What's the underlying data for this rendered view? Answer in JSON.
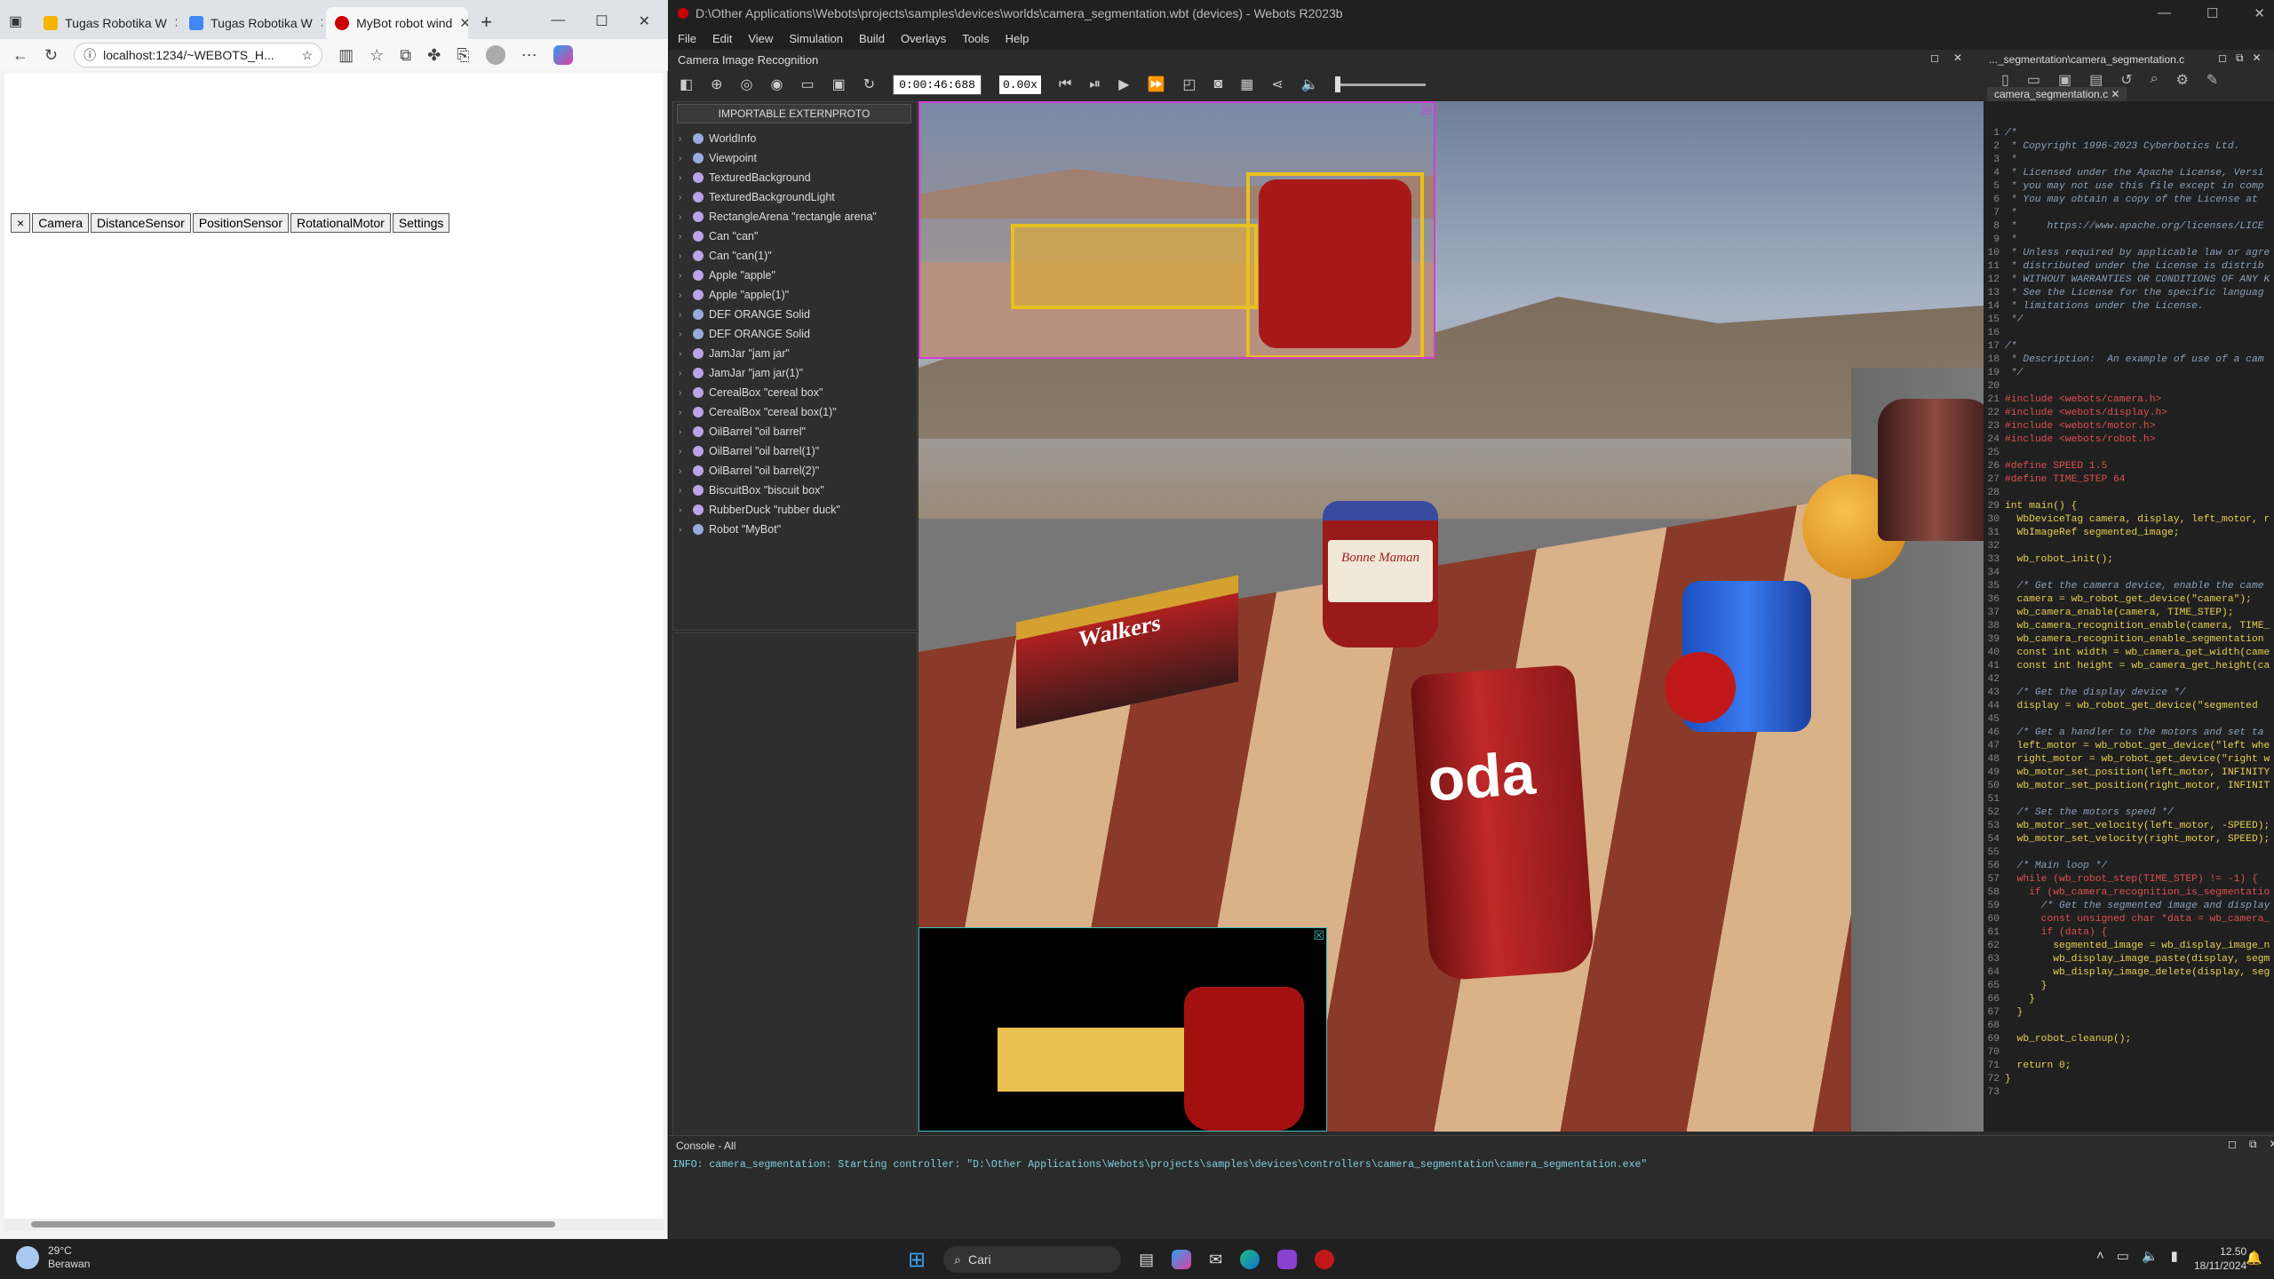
{
  "browser": {
    "tabs": [
      {
        "label": "Tugas Robotika W",
        "color": "#f4b400"
      },
      {
        "label": "Tugas Robotika W",
        "color": "#4285f4"
      },
      {
        "label": "MyBot robot wind",
        "color": "#c00"
      }
    ],
    "address": "localhost:1234/~WEBOTS_H...",
    "device_tabs": [
      "×",
      "Camera",
      "DistanceSensor",
      "PositionSensor",
      "RotationalMotor",
      "Settings"
    ]
  },
  "webots": {
    "title": "D:\\Other Applications\\Webots\\projects\\samples\\devices\\worlds\\camera_segmentation.wbt (devices) - Webots R2023b",
    "menu": [
      "File",
      "Edit",
      "View",
      "Simulation",
      "Build",
      "Overlays",
      "Tools",
      "Help"
    ],
    "panel_title": "Camera Image Recognition",
    "time": "0:00:46:688",
    "speed": "0.00x",
    "extern_button": "IMPORTABLE EXTERNPROTO",
    "tree": [
      {
        "label": "WorldInfo",
        "c": "b"
      },
      {
        "label": "Viewpoint",
        "c": "b"
      },
      {
        "label": "TexturedBackground",
        "c": "p"
      },
      {
        "label": "TexturedBackgroundLight",
        "c": "p"
      },
      {
        "label": "RectangleArena \"rectangle arena\"",
        "c": "p"
      },
      {
        "label": "Can \"can\"",
        "c": "p"
      },
      {
        "label": "Can \"can(1)\"",
        "c": "p"
      },
      {
        "label": "Apple \"apple\"",
        "c": "p"
      },
      {
        "label": "Apple \"apple(1)\"",
        "c": "p"
      },
      {
        "label": "DEF ORANGE Solid",
        "c": "b"
      },
      {
        "label": "DEF ORANGE Solid",
        "c": "b"
      },
      {
        "label": "JamJar \"jam jar\"",
        "c": "p"
      },
      {
        "label": "JamJar \"jam jar(1)\"",
        "c": "p"
      },
      {
        "label": "CerealBox \"cereal box\"",
        "c": "p"
      },
      {
        "label": "CerealBox \"cereal box(1)\"",
        "c": "p"
      },
      {
        "label": "OilBarrel \"oil barrel\"",
        "c": "p"
      },
      {
        "label": "OilBarrel \"oil barrel(1)\"",
        "c": "p"
      },
      {
        "label": "OilBarrel \"oil barrel(2)\"",
        "c": "p"
      },
      {
        "label": "BiscuitBox \"biscuit box\"",
        "c": "p"
      },
      {
        "label": "RubberDuck \"rubber duck\"",
        "c": "p"
      },
      {
        "label": "Robot \"MyBot\"",
        "c": "b"
      }
    ],
    "editor_title": "..._segmentation\\camera_segmentation.c",
    "editor_tab": "camera_segmentation.c",
    "console_title": "Console - All",
    "console_line": "INFO: camera_segmentation: Starting controller: \"D:\\Other Applications\\Webots\\projects\\samples\\devices\\controllers\\camera_segmentation\\camera_segmentation.exe\"",
    "scene_labels": {
      "biscuit": "Walkers",
      "soda": "oda",
      "jam": "Bonne Maman"
    }
  },
  "code": [
    [
      "cm",
      "/*"
    ],
    [
      "cm",
      " * Copyright 1996-2023 Cyberbotics Ltd."
    ],
    [
      "cm",
      " *"
    ],
    [
      "cm",
      " * Licensed under the Apache License, Versi"
    ],
    [
      "cm",
      " * you may not use this file except in comp"
    ],
    [
      "cm",
      " * You may obtain a copy of the License at"
    ],
    [
      "cm",
      " *"
    ],
    [
      "cm",
      " *     https://www.apache.org/licenses/LICE"
    ],
    [
      "cm",
      " *"
    ],
    [
      "cm",
      " * Unless required by applicable law or agre"
    ],
    [
      "cm",
      " * distributed under the License is distrib"
    ],
    [
      "cm",
      " * WITHOUT WARRANTIES OR CONDITIONS OF ANY K"
    ],
    [
      "cm",
      " * See the License for the specific languag"
    ],
    [
      "cm",
      " * limitations under the License."
    ],
    [
      "cm",
      " */"
    ],
    [
      "",
      ""
    ],
    [
      "cm",
      "/*"
    ],
    [
      "cm",
      " * Description:  An example of use of a cam"
    ],
    [
      "cm",
      " */"
    ],
    [
      "",
      ""
    ],
    [
      "pp",
      "#include <webots/camera.h>"
    ],
    [
      "pp",
      "#include <webots/display.h>"
    ],
    [
      "pp",
      "#include <webots/motor.h>"
    ],
    [
      "pp",
      "#include <webots/robot.h>"
    ],
    [
      "",
      ""
    ],
    [
      "pp",
      "#define SPEED 1.5"
    ],
    [
      "pp",
      "#define TIME_STEP 64"
    ],
    [
      "",
      ""
    ],
    [
      "tx",
      "int main() {"
    ],
    [
      "tx",
      "  WbDeviceTag camera, display, left_motor, r"
    ],
    [
      "tx",
      "  WbImageRef segmented_image;"
    ],
    [
      "",
      ""
    ],
    [
      "tx",
      "  wb_robot_init();"
    ],
    [
      "",
      ""
    ],
    [
      "cm",
      "  /* Get the camera device, enable the came"
    ],
    [
      "tx",
      "  camera = wb_robot_get_device(\"camera\");"
    ],
    [
      "tx",
      "  wb_camera_enable(camera, TIME_STEP);"
    ],
    [
      "tx",
      "  wb_camera_recognition_enable(camera, TIME_"
    ],
    [
      "tx",
      "  wb_camera_recognition_enable_segmentation"
    ],
    [
      "tx",
      "  const int width = wb_camera_get_width(came"
    ],
    [
      "tx",
      "  const int height = wb_camera_get_height(ca"
    ],
    [
      "",
      ""
    ],
    [
      "cm",
      "  /* Get the display device */"
    ],
    [
      "tx",
      "  display = wb_robot_get_device(\"segmented "
    ],
    [
      "",
      ""
    ],
    [
      "cm",
      "  /* Get a handler to the motors and set ta"
    ],
    [
      "tx",
      "  left_motor = wb_robot_get_device(\"left whe"
    ],
    [
      "tx",
      "  right_motor = wb_robot_get_device(\"right w"
    ],
    [
      "tx",
      "  wb_motor_set_position(left_motor, INFINITY"
    ],
    [
      "tx",
      "  wb_motor_set_position(right_motor, INFINIT"
    ],
    [
      "",
      ""
    ],
    [
      "cm",
      "  /* Set the motors speed */"
    ],
    [
      "tx",
      "  wb_motor_set_velocity(left_motor, -SPEED);"
    ],
    [
      "tx",
      "  wb_motor_set_velocity(right_motor, SPEED);"
    ],
    [
      "",
      ""
    ],
    [
      "cm",
      "  /* Main loop */"
    ],
    [
      "kw",
      "  while (wb_robot_step(TIME_STEP) != -1) {"
    ],
    [
      "kw",
      "    if (wb_camera_recognition_is_segmentatio"
    ],
    [
      "cm",
      "      /* Get the segmented image and display"
    ],
    [
      "kw",
      "      const unsigned char *data = wb_camera_"
    ],
    [
      "kw",
      "      if (data) {"
    ],
    [
      "tx",
      "        segmented_image = wb_display_image_n"
    ],
    [
      "tx",
      "        wb_display_image_paste(display, segm"
    ],
    [
      "tx",
      "        wb_display_image_delete(display, seg"
    ],
    [
      "tx",
      "      }"
    ],
    [
      "tx",
      "    }"
    ],
    [
      "tx",
      "  }"
    ],
    [
      "",
      ""
    ],
    [
      "tx",
      "  wb_robot_cleanup();"
    ],
    [
      "",
      ""
    ],
    [
      "tx",
      "  return 0;"
    ],
    [
      "tx",
      "}"
    ],
    [
      "",
      ""
    ]
  ],
  "taskbar": {
    "temp": "29°C",
    "weather": "Berawan",
    "search": "Cari",
    "time": "12.50",
    "date": "18/11/2024"
  }
}
